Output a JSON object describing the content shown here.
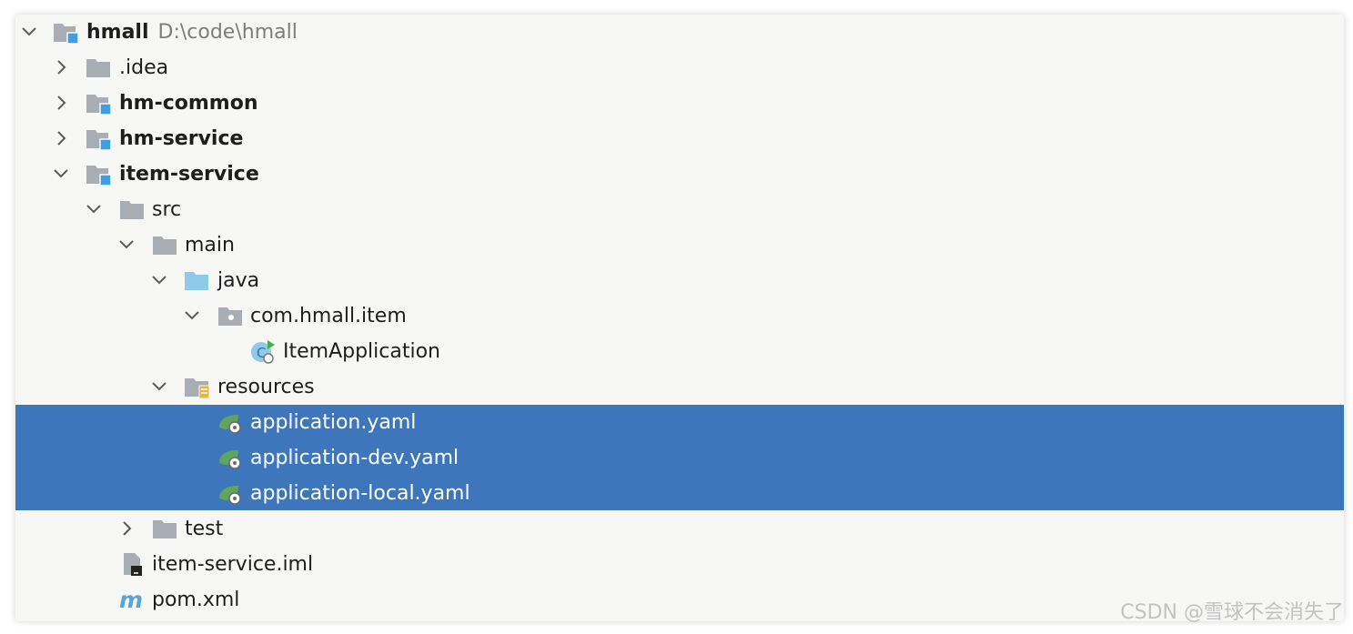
{
  "tree": {
    "root": {
      "label": "hmall",
      "path": "D:\\code\\hmall"
    },
    "items": [
      {
        "label": ".idea"
      },
      {
        "label": "hm-common"
      },
      {
        "label": "hm-service"
      },
      {
        "label": "item-service"
      },
      {
        "label": "src"
      },
      {
        "label": "main"
      },
      {
        "label": "java"
      },
      {
        "label": "com.hmall.item"
      },
      {
        "label": "ItemApplication"
      },
      {
        "label": "resources"
      },
      {
        "label": "application.yaml"
      },
      {
        "label": "application-dev.yaml"
      },
      {
        "label": "application-local.yaml"
      },
      {
        "label": "test"
      },
      {
        "label": "item-service.iml"
      },
      {
        "label": "pom.xml"
      }
    ]
  },
  "colors": {
    "selection": "#3d76bb",
    "folder": "#a9aeb5",
    "module_badge": "#3f9fe0",
    "source_folder": "#8ecbe9",
    "spring_green": "#5fa55a"
  },
  "watermark": "CSDN @雪球不会消失了"
}
